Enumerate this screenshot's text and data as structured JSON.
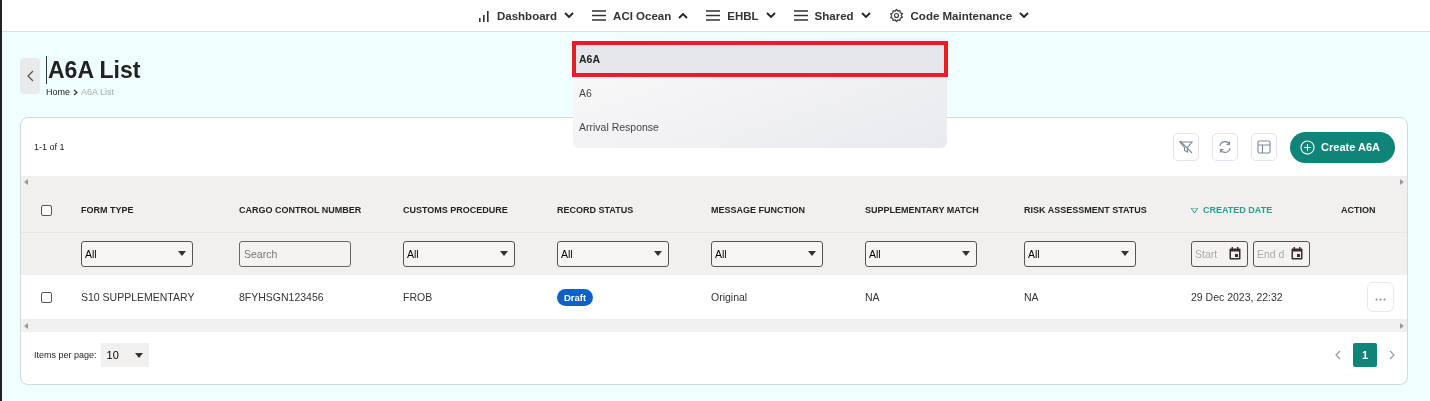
{
  "nav": [
    {
      "label": "Dashboard",
      "kind": "chart",
      "expanded": false
    },
    {
      "label": "ACI Ocean",
      "kind": "menu",
      "expanded": true
    },
    {
      "label": "EHBL",
      "kind": "menu",
      "expanded": false
    },
    {
      "label": "Shared",
      "kind": "menu",
      "expanded": false
    },
    {
      "label": "Code Maintenance",
      "kind": "settings",
      "expanded": false
    }
  ],
  "dropdown": [
    {
      "label": "A6A",
      "selected": true
    },
    {
      "label": "A6",
      "selected": false
    },
    {
      "label": "Arrival Response",
      "selected": false
    }
  ],
  "page": {
    "title": "A6A List",
    "breadcrumb": [
      "Home",
      "A6A List"
    ]
  },
  "table": {
    "range": "1-1 of 1",
    "create_button": "Create A6A",
    "columns": [
      {
        "label": "FORM TYPE",
        "sorted": false,
        "filter": {
          "kind": "select",
          "value": "All"
        }
      },
      {
        "label": "CARGO CONTROL NUMBER",
        "sorted": false,
        "filter": {
          "kind": "search",
          "placeholder": "Search"
        }
      },
      {
        "label": "CUSTOMS PROCEDURE",
        "sorted": false,
        "filter": {
          "kind": "select",
          "value": "All"
        }
      },
      {
        "label": "RECORD STATUS",
        "sorted": false,
        "filter": {
          "kind": "select",
          "value": "All"
        }
      },
      {
        "label": "MESSAGE FUNCTION",
        "sorted": false,
        "filter": {
          "kind": "select",
          "value": "All"
        }
      },
      {
        "label": "SUPPLEMENTARY MATCH",
        "sorted": false,
        "filter": {
          "kind": "select",
          "value": "All"
        }
      },
      {
        "label": "RISK ASSESSMENT STATUS",
        "sorted": false,
        "filter": {
          "kind": "select",
          "value": "All"
        }
      },
      {
        "label": "CREATED DATE",
        "sorted": true,
        "filter": {
          "kind": "daterange",
          "start_placeholder": "Start",
          "end_placeholder": "End d"
        }
      },
      {
        "label": "ACTION",
        "sorted": false
      }
    ],
    "header_checked": false,
    "rows": [
      {
        "checked": false,
        "cells": [
          {
            "kind": "text",
            "text": "S10 SUPPLEMENTARY"
          },
          {
            "kind": "text",
            "text": "8FYHSGN123456"
          },
          {
            "kind": "text",
            "text": "FROB"
          },
          {
            "kind": "badge",
            "text": "Draft",
            "color": "#0d62c9"
          },
          {
            "kind": "text",
            "text": "Original"
          },
          {
            "kind": "text",
            "text": "NA"
          },
          {
            "kind": "text",
            "text": "NA"
          },
          {
            "kind": "text",
            "text": "29 Dec 2023, 22:32"
          },
          {
            "kind": "menu"
          }
        ]
      }
    ],
    "items_per_page_label": "Items per page:",
    "items_per_page": "10",
    "pages": [
      {
        "label": "1",
        "selected": true
      }
    ]
  }
}
